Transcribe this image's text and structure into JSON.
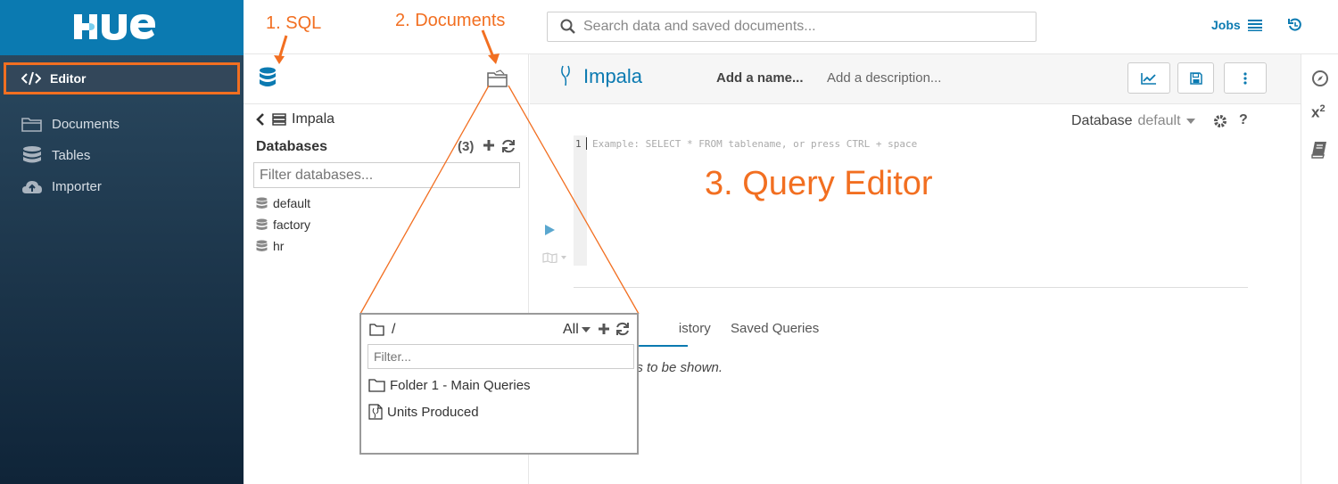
{
  "brand": {
    "logo_text": "HUE"
  },
  "sidebar": {
    "items": [
      {
        "label": "Editor",
        "icon": "code-icon"
      },
      {
        "label": "Documents",
        "icon": "folder-open-icon"
      },
      {
        "label": "Tables",
        "icon": "database-icon"
      },
      {
        "label": "Importer",
        "icon": "cloud-upload-icon"
      }
    ]
  },
  "topbar": {
    "search_placeholder": "Search data and saved documents...",
    "jobs_label": "Jobs"
  },
  "annotations": {
    "sql": "1. SQL",
    "documents": "2. Documents",
    "query_editor": "3. Query Editor"
  },
  "left_panel": {
    "breadcrumb": "Impala",
    "databases_title": "Databases",
    "databases_count": "(3)",
    "filter_placeholder": "Filter databases...",
    "databases": [
      "default",
      "factory",
      "hr"
    ]
  },
  "editor": {
    "engine_title": "Impala",
    "name_placeholder": "Add a name...",
    "description_placeholder": "Add a description...",
    "database_label": "Database",
    "database_value": "default",
    "line_number": "1",
    "code_placeholder": "Example: SELECT * FROM tablename, or press CTRL + space",
    "tabs": [
      "Query History",
      "Saved Queries"
    ],
    "history_tab_visible": "istory",
    "empty_message_visible": "es to be shown."
  },
  "doc_popup": {
    "path": "/",
    "filter_option": "All",
    "filter_placeholder": "Filter...",
    "items": [
      {
        "label": "Folder 1 - Main Queries",
        "icon": "folder-icon"
      },
      {
        "label": "Units Produced",
        "icon": "impala-document-icon"
      }
    ]
  },
  "colors": {
    "accent": "#0b7ab1",
    "annotation": "#f26f21",
    "sidebar": "#1f3a52"
  }
}
